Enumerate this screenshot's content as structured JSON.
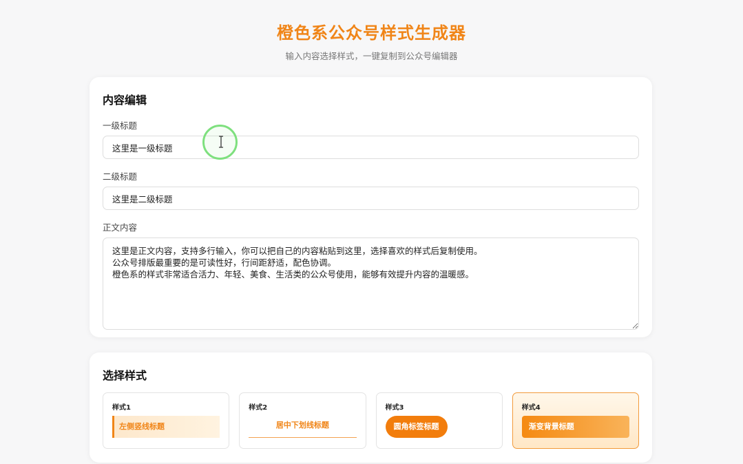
{
  "header": {
    "title": "橙色系公众号样式生成器",
    "subtitle": "输入内容选择样式，一键复制到公众号编辑器"
  },
  "editor": {
    "section_title": "内容编辑",
    "h1_label": "一级标题",
    "h1_value": "这里是一级标题",
    "h2_label": "二级标题",
    "h2_value": "这里是二级标题",
    "body_label": "正文内容",
    "body_value": "这里是正文内容，支持多行输入，你可以把自己的内容粘贴到这里，选择喜欢的样式后复制使用。\n公众号排版最重要的是可读性好，行间距舒适，配色协调。\n橙色系的样式非常适合活力、年轻、美食、生活类的公众号使用，能够有效提升内容的温暖感。"
  },
  "styles": {
    "section_title": "选择样式",
    "selected_index": 3,
    "items": [
      {
        "name": "样式1",
        "demo": "左侧竖线标题"
      },
      {
        "name": "样式2",
        "demo": "居中下划线标题"
      },
      {
        "name": "样式3",
        "demo": "圆角标签标题"
      },
      {
        "name": "样式4",
        "demo": "渐变背景标题"
      }
    ]
  },
  "colors": {
    "accent": "#f08518",
    "cursor_ring": "#7ee07e"
  },
  "icons": {
    "cursor": "text-cursor-icon"
  }
}
